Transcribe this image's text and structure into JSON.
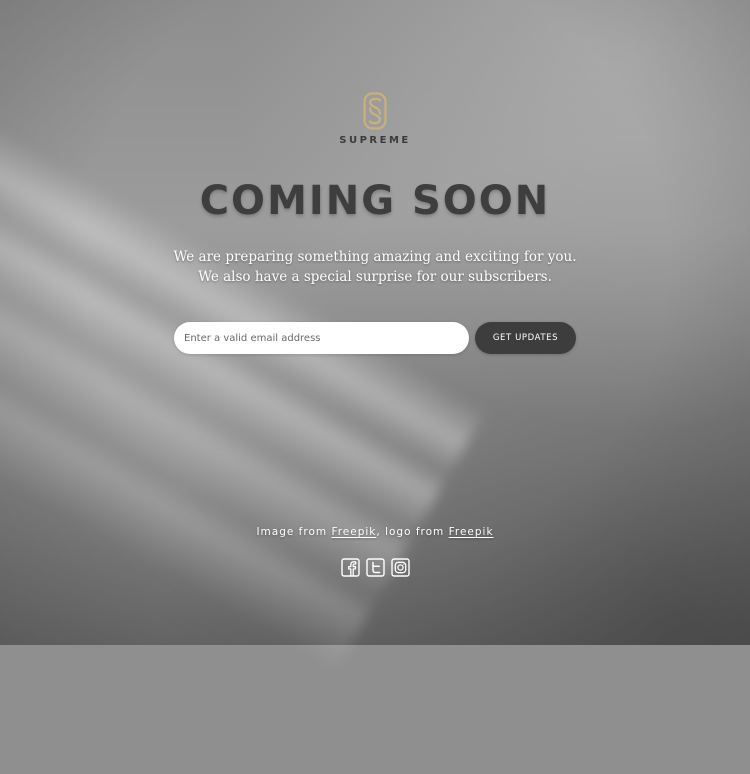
{
  "brand": {
    "name": "SUPREME",
    "logo_icon": "s-monogram-icon",
    "logo_color": "#c9b27a"
  },
  "hero": {
    "title": "COMING SOON",
    "subtitle": "We are preparing something amazing and exciting for you. We also have a special surprise for our subscribers."
  },
  "form": {
    "email_placeholder": "Enter a valid email address",
    "email_value": "",
    "submit_label": "GET UPDATES"
  },
  "credits": {
    "prefix": "Image from ",
    "link1": "Freepik",
    "middle": ", logo from ",
    "link2": "Freepik"
  },
  "social": [
    {
      "name": "facebook",
      "icon": "facebook-icon"
    },
    {
      "name": "twitter",
      "icon": "twitter-icon"
    },
    {
      "name": "instagram",
      "icon": "instagram-icon"
    }
  ],
  "colors": {
    "title": "#3e3e3e",
    "button_bg": "#3d3d3d",
    "text_light": "#ffffff"
  }
}
